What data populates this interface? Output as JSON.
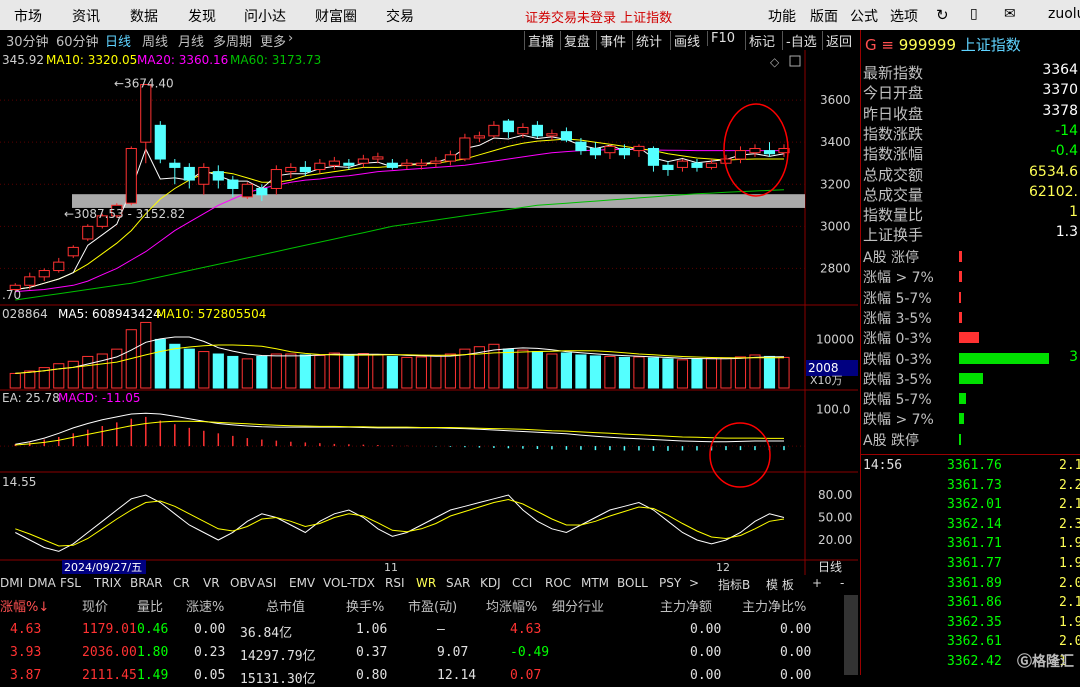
{
  "menu": {
    "items": [
      "市场",
      "资讯",
      "数据",
      "发现",
      "问小达",
      "财富圈",
      "交易"
    ],
    "notice": "证券交易未登录  上证指数",
    "right": [
      "功能",
      "版面",
      "公式",
      "选项"
    ],
    "user": "zuolu"
  },
  "periods": [
    "30分钟",
    "60分钟",
    "日线",
    "周线",
    "月线",
    "多周期",
    "更多"
  ],
  "active_period": "日线",
  "toolbar_right": [
    "直播",
    "复盘",
    "事件",
    "统计",
    "画线",
    "F10",
    "标记",
    "-自选",
    "返回"
  ],
  "main_ma": {
    "close_label": "345.92",
    "ma10": "MA10: 3320.05",
    "ma20": "MA20: 3360.16",
    "ma60": "MA60: 3173.73"
  },
  "vol_ma": {
    "label": "028864",
    "ma5": "MA5: 608943424",
    "ma10": "MA10: 572805504"
  },
  "macd_label": {
    "dea": "EA: 25.78",
    "macd": "MACD: -11.05"
  },
  "osc_label": "14.55",
  "chart_data": {
    "type": "candlestick",
    "price_axis": {
      "ylim": [
        2650,
        3800
      ],
      "ticks": [
        2800,
        3000,
        3200,
        3400,
        3600
      ]
    },
    "annotations": {
      "high": "3674.40",
      "range": "3087.53 - 3152.82",
      "low_label": ".70"
    },
    "candles": [
      [
        2700,
        2720,
        2690,
        2730
      ],
      [
        2720,
        2760,
        2700,
        2780
      ],
      [
        2760,
        2790,
        2740,
        2800
      ],
      [
        2790,
        2830,
        2780,
        2850
      ],
      [
        2860,
        2900,
        2850,
        2910
      ],
      [
        2940,
        3000,
        2930,
        3010
      ],
      [
        3000,
        3050,
        2990,
        3060
      ],
      [
        3050,
        3100,
        3040,
        3110
      ],
      [
        3110,
        3370,
        3100,
        3380
      ],
      [
        3400,
        3674,
        3300,
        3674
      ],
      [
        3480,
        3320,
        3300,
        3500
      ],
      [
        3300,
        3280,
        3200,
        3320
      ],
      [
        3280,
        3220,
        3180,
        3300
      ],
      [
        3200,
        3280,
        3150,
        3300
      ],
      [
        3260,
        3220,
        3180,
        3290
      ],
      [
        3220,
        3180,
        3140,
        3240
      ],
      [
        3140,
        3200,
        3130,
        3210
      ],
      [
        3180,
        3150,
        3120,
        3200
      ],
      [
        3180,
        3270,
        3150,
        3290
      ],
      [
        3260,
        3280,
        3230,
        3300
      ],
      [
        3280,
        3260,
        3240,
        3310
      ],
      [
        3270,
        3300,
        3250,
        3320
      ],
      [
        3290,
        3310,
        3270,
        3330
      ],
      [
        3300,
        3290,
        3270,
        3320
      ],
      [
        3300,
        3320,
        3280,
        3340
      ],
      [
        3320,
        3330,
        3300,
        3350
      ],
      [
        3300,
        3280,
        3270,
        3320
      ],
      [
        3290,
        3300,
        3270,
        3320
      ],
      [
        3290,
        3300,
        3270,
        3320
      ],
      [
        3300,
        3310,
        3280,
        3330
      ],
      [
        3310,
        3340,
        3290,
        3360
      ],
      [
        3320,
        3420,
        3310,
        3440
      ],
      [
        3420,
        3430,
        3400,
        3450
      ],
      [
        3430,
        3480,
        3420,
        3500
      ],
      [
        3500,
        3450,
        3420,
        3510
      ],
      [
        3440,
        3470,
        3420,
        3490
      ],
      [
        3480,
        3430,
        3420,
        3500
      ],
      [
        3430,
        3440,
        3410,
        3460
      ],
      [
        3450,
        3410,
        3400,
        3470
      ],
      [
        3400,
        3360,
        3340,
        3420
      ],
      [
        3370,
        3340,
        3320,
        3400
      ],
      [
        3350,
        3380,
        3320,
        3390
      ],
      [
        3370,
        3340,
        3320,
        3390
      ],
      [
        3360,
        3380,
        3330,
        3390
      ],
      [
        3370,
        3290,
        3260,
        3380
      ],
      [
        3290,
        3270,
        3240,
        3310
      ],
      [
        3280,
        3310,
        3260,
        3320
      ],
      [
        3300,
        3280,
        3260,
        3320
      ],
      [
        3280,
        3300,
        3270,
        3320
      ],
      [
        3300,
        3320,
        3290,
        3340
      ],
      [
        3320,
        3360,
        3300,
        3380
      ],
      [
        3350,
        3370,
        3330,
        3390
      ],
      [
        3360,
        3345,
        3330,
        3400
      ],
      [
        3350,
        3370,
        3330,
        3390
      ]
    ],
    "ma10": [
      2700,
      2710,
      2730,
      2750,
      2780,
      2820,
      2870,
      2920,
      2980,
      3060,
      3130,
      3180,
      3220,
      3250,
      3260,
      3250,
      3230,
      3210,
      3210,
      3220,
      3240,
      3250,
      3260,
      3270,
      3280,
      3280,
      3285,
      3290,
      3295,
      3300,
      3310,
      3320,
      3340,
      3360,
      3380,
      3395,
      3405,
      3410,
      3415,
      3410,
      3400,
      3390,
      3380,
      3370,
      3360,
      3345,
      3335,
      3325,
      3320,
      3315,
      3318,
      3320,
      3320,
      3320
    ],
    "ma20": [
      2690,
      2695,
      2700,
      2710,
      2720,
      2740,
      2770,
      2800,
      2840,
      2880,
      2930,
      2980,
      3020,
      3060,
      3100,
      3130,
      3160,
      3180,
      3195,
      3210,
      3220,
      3225,
      3235,
      3240,
      3250,
      3260,
      3265,
      3270,
      3275,
      3280,
      3285,
      3290,
      3300,
      3310,
      3320,
      3330,
      3340,
      3350,
      3355,
      3360,
      3362,
      3365,
      3365,
      3365,
      3363,
      3362,
      3361,
      3360,
      3360,
      3360,
      3360,
      3360,
      3360,
      3360
    ],
    "ma60": [
      2650,
      2660,
      2670,
      2680,
      2690,
      2700,
      2710,
      2720,
      2730,
      2745,
      2760,
      2775,
      2790,
      2805,
      2820,
      2835,
      2850,
      2865,
      2880,
      2895,
      2910,
      2925,
      2940,
      2955,
      2970,
      2985,
      3000,
      3010,
      3020,
      3030,
      3040,
      3050,
      3060,
      3070,
      3080,
      3090,
      3100,
      3105,
      3110,
      3115,
      3120,
      3125,
      3130,
      3135,
      3140,
      3145,
      3150,
      3155,
      3158,
      3162,
      3165,
      3168,
      3171,
      3174
    ],
    "volume": {
      "ylim": [
        0,
        14000
      ],
      "ticks": [
        10000
      ],
      "unit_label": "X10万",
      "current_label": "2008",
      "values": [
        3000,
        3500,
        4200,
        5000,
        5500,
        6500,
        7000,
        8000,
        12000,
        13500,
        10000,
        9000,
        8000,
        7500,
        7000,
        6500,
        6000,
        6500,
        7000,
        7000,
        6800,
        6700,
        7200,
        6900,
        7100,
        6800,
        6500,
        6300,
        6400,
        6600,
        7000,
        8000,
        8500,
        9000,
        8000,
        7800,
        7500,
        7000,
        7200,
        6800,
        6600,
        6500,
        6300,
        6400,
        6200,
        6000,
        5800,
        6000,
        6100,
        6200,
        6400,
        6800,
        6500,
        6300
      ]
    },
    "macd": {
      "ylim": [
        -60,
        140
      ],
      "ticks": [
        100.0
      ],
      "tick_label": "100.0",
      "hist": [
        5,
        10,
        18,
        25,
        35,
        45,
        55,
        65,
        75,
        80,
        70,
        60,
        50,
        42,
        35,
        28,
        22,
        18,
        15,
        12,
        10,
        8,
        6,
        5,
        4,
        3,
        2,
        1,
        0,
        -1,
        -2,
        -3,
        -4,
        -5,
        -6,
        -7,
        -8,
        -9,
        -10,
        -10,
        -11,
        -11,
        -12,
        -12,
        -13,
        -13,
        -12,
        -12,
        -12,
        -11,
        -11,
        -11,
        -11,
        -11
      ],
      "dif": [
        5,
        12,
        22,
        35,
        50,
        62,
        72,
        80,
        88,
        90,
        88,
        82,
        75,
        68,
        62,
        58,
        55,
        53,
        52,
        52,
        52,
        52,
        52,
        52,
        51,
        50,
        50,
        50,
        50,
        50,
        49,
        48,
        46,
        44,
        42,
        40,
        38,
        36,
        34,
        30,
        27,
        24,
        22,
        20,
        18,
        16,
        14,
        13,
        12,
        12,
        13,
        14,
        14,
        14
      ],
      "dea": [
        3,
        6,
        10,
        16,
        24,
        32,
        40,
        48,
        56,
        62,
        66,
        68,
        68,
        67,
        65,
        63,
        61,
        59,
        57,
        56,
        55,
        54,
        54,
        53,
        53,
        52,
        52,
        52,
        51,
        51,
        51,
        50,
        49,
        48,
        47,
        46,
        44,
        42,
        41,
        39,
        37,
        35,
        33,
        31,
        29,
        27,
        25,
        24,
        23,
        22,
        22,
        22,
        21,
        21
      ]
    },
    "osc": {
      "ylim": [
        0,
        100
      ],
      "ticks": [
        80.0,
        50.0,
        20.0
      ],
      "tick_labels": [
        "80.00",
        "50.00",
        "20.00"
      ],
      "k": [
        30,
        20,
        10,
        5,
        15,
        30,
        45,
        60,
        75,
        80,
        70,
        55,
        40,
        30,
        20,
        30,
        45,
        55,
        50,
        40,
        30,
        45,
        55,
        60,
        50,
        35,
        25,
        30,
        40,
        50,
        60,
        65,
        70,
        75,
        80,
        60,
        45,
        35,
        30,
        40,
        50,
        60,
        65,
        70,
        60,
        45,
        30,
        20,
        15,
        20,
        30,
        45,
        55,
        50
      ],
      "d": [
        35,
        28,
        20,
        12,
        13,
        22,
        35,
        48,
        60,
        70,
        72,
        65,
        55,
        45,
        35,
        32,
        38,
        48,
        50,
        45,
        38,
        42,
        50,
        55,
        52,
        43,
        33,
        31,
        35,
        42,
        52,
        58,
        64,
        70,
        74,
        68,
        58,
        48,
        40,
        40,
        45,
        52,
        58,
        64,
        62,
        53,
        42,
        32,
        24,
        22,
        26,
        35,
        45,
        48
      ]
    },
    "x_labels": {
      "date": "2024/09/27/五",
      "nov": "11",
      "dec": "12"
    }
  },
  "indicator_tabs": [
    "DMI",
    "DMA",
    "FSL",
    "TRIX",
    "BRAR",
    "CR",
    "VR",
    "OBV",
    "ASI",
    "EMV",
    "VOL-TDX",
    "RSI",
    "WR",
    "SAR",
    "KDJ",
    "CCI",
    "ROC",
    "MTM",
    "BOLL",
    "PSY",
    ">",
    "指标B",
    "模 板",
    "+",
    "-"
  ],
  "active_indicator": "WR",
  "list": {
    "headers": [
      "涨幅%↓",
      "现价",
      "量比",
      "涨速%",
      "总市值",
      "换手%",
      "市盈(动)",
      "均涨幅%",
      "细分行业",
      "主力净额",
      "主力净比%"
    ],
    "rows": [
      [
        "4.63",
        "1179.01",
        "0.46",
        "0.00",
        "36.84亿",
        "1.06",
        "–",
        "4.63",
        "",
        "0.00",
        "0.00"
      ],
      [
        "3.93",
        "2036.00",
        "1.80",
        "0.23",
        "14297.79亿",
        "0.37",
        "9.07",
        "-0.49",
        "",
        "0.00",
        "0.00"
      ],
      [
        "3.87",
        "2111.45",
        "1.49",
        "0.05",
        "15131.30亿",
        "0.80",
        "12.14",
        "0.07",
        "",
        "0.00",
        "0.00"
      ]
    ]
  },
  "right_panel": {
    "code": "999999",
    "name": "上证指数",
    "prefix": "G ≡",
    "stats": [
      [
        "最新指数",
        "3364"
      ],
      [
        "今日开盘",
        "3370"
      ],
      [
        "昨日收盘",
        "3378"
      ],
      [
        "指数涨跌",
        "-14"
      ],
      [
        "指数涨幅",
        "-0.4"
      ],
      [
        "总成交额",
        "6534.6"
      ],
      [
        "总成交量",
        "62102."
      ],
      [
        "指数量比",
        "1"
      ],
      [
        "上证换手",
        "1.3"
      ]
    ],
    "advdec": [
      [
        "A股 涨停",
        ""
      ],
      [
        "涨幅 > 7%",
        ""
      ],
      [
        "涨幅 5-7%",
        ""
      ],
      [
        "涨幅 3-5%",
        ""
      ],
      [
        "涨幅 0-3%",
        ""
      ],
      [
        "跌幅 0-3%",
        "3"
      ],
      [
        "跌幅 3-5%",
        ""
      ],
      [
        "跌幅 5-7%",
        ""
      ],
      [
        "跌幅 > 7%",
        ""
      ],
      [
        "A股 跌停",
        ""
      ]
    ],
    "advdec_bar_values": [
      0.02,
      0.02,
      0.01,
      0.02,
      0.12,
      0.53,
      0.14,
      0.04,
      0.03,
      0.01
    ],
    "ticks_header_time": "14:56",
    "ticks": [
      [
        "3361.76",
        "2.1"
      ],
      [
        "3361.73",
        "2.2"
      ],
      [
        "3362.01",
        "2.1"
      ],
      [
        "3362.14",
        "2.3"
      ],
      [
        "3361.71",
        "1.9"
      ],
      [
        "3361.77",
        "1.9"
      ],
      [
        "3361.89",
        "2.0"
      ],
      [
        "3361.86",
        "2.1"
      ],
      [
        "3362.35",
        "1.9"
      ],
      [
        "3362.61",
        "2.0"
      ],
      [
        "3362.42",
        "1"
      ]
    ],
    "logo": "格隆汇"
  },
  "colors": {
    "up": "#ff3232",
    "down": "#54ffff",
    "ma10": "#ffffff",
    "ma20": "#ffff00",
    "ma60": "#00c000",
    "ma_extra": "#ff00ff",
    "circle": "#ff0000"
  }
}
